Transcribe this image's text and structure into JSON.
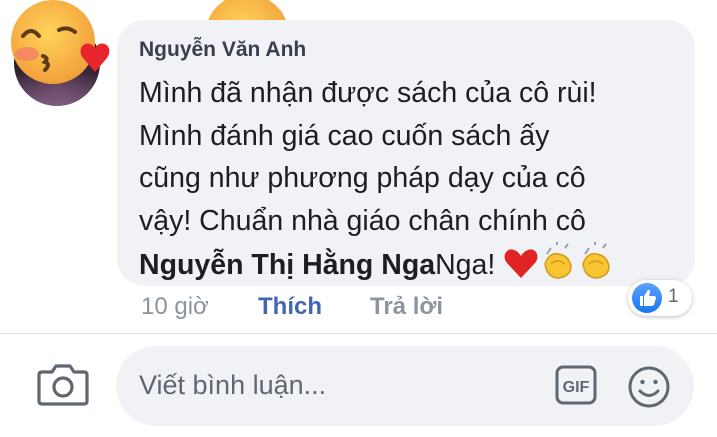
{
  "comment": {
    "author": "Nguyễn Văn Anh",
    "text_line1": "Mình đã nhận được sách của cô rùi!",
    "text_line2": "Mình đánh giá cao cuốn sách ấy",
    "text_line3": "cũng như phương pháp dạy của cô",
    "text_line4": "vậy! Chuẩn nhà giáo chân chính cô",
    "mention": "Nguyễn Thị Hằng Nga",
    "text_after_mention": "Nga! ",
    "inline_emojis": [
      "heart-emoji",
      "clapping-hands-emoji",
      "clapping-hands-emoji"
    ]
  },
  "actions": {
    "time": "10 giờ",
    "like": "Thích",
    "reply": "Trả lời"
  },
  "reactions": {
    "icon": "like-thumb-icon",
    "count": "1"
  },
  "composer": {
    "placeholder": "Viết bình luận...",
    "gif_label": "GIF",
    "camera_icon": "camera-icon",
    "emoji_icon": "smiley-icon"
  },
  "colors": {
    "bubble_bg": "#f1f2f6",
    "link_blue": "#4267b2",
    "meta_gray": "#8d949e",
    "like_blue": "#1877f2",
    "heart_red": "#e02424"
  }
}
